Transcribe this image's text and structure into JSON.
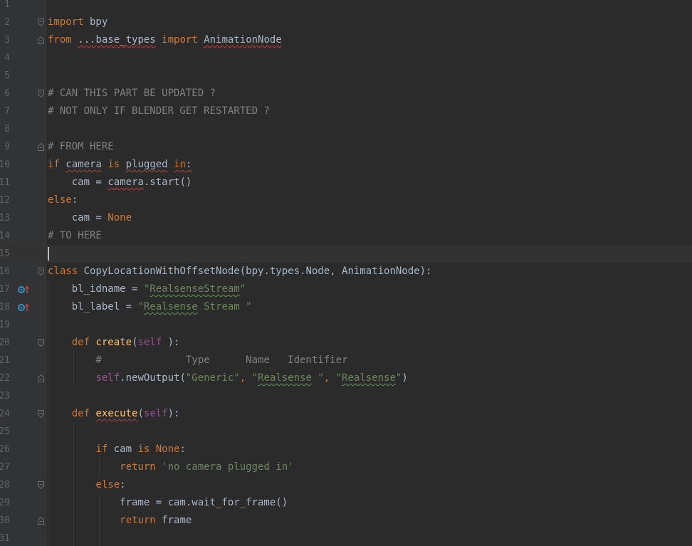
{
  "editor": {
    "language": "python",
    "current_line": "15",
    "colors": {
      "background": "#2b2b2b",
      "gutter": "#313335",
      "line_number": "#606366",
      "keyword": "#cc7832",
      "comment": "#808080",
      "string": "#6a8759",
      "self": "#94558d",
      "function": "#ffc66d",
      "text": "#a9b7c6",
      "warning_red": "#bc3f3c",
      "typo_green": "#629755",
      "override_icon": "#3592c4"
    },
    "lines": [
      {
        "n": "1",
        "tokens": []
      },
      {
        "n": "2",
        "fold": "start",
        "tokens": [
          {
            "t": "import",
            "c": "kw"
          },
          {
            "t": " bpy",
            "c": "tx"
          }
        ]
      },
      {
        "n": "3",
        "fold": "end",
        "tokens": [
          {
            "t": "from",
            "c": "kw"
          },
          {
            "t": " ",
            "c": "tx"
          },
          {
            "t": "...base_types",
            "c": "tx",
            "u": "red"
          },
          {
            "t": " ",
            "c": "tx"
          },
          {
            "t": "import",
            "c": "kw"
          },
          {
            "t": " ",
            "c": "tx"
          },
          {
            "t": "AnimationNode",
            "c": "tx",
            "u": "red"
          }
        ]
      },
      {
        "n": "4",
        "tokens": []
      },
      {
        "n": "5",
        "tokens": []
      },
      {
        "n": "6",
        "fold": "start",
        "tokens": [
          {
            "t": "# CAN THIS PART BE UPDATED ?",
            "c": "cm"
          }
        ]
      },
      {
        "n": "7",
        "tokens": [
          {
            "t": "# NOT ONLY IF BLENDER GET RESTARTED ?",
            "c": "cm"
          }
        ]
      },
      {
        "n": "8",
        "tokens": []
      },
      {
        "n": "9",
        "fold": "end",
        "tokens": [
          {
            "t": "# FROM HERE",
            "c": "cm"
          }
        ]
      },
      {
        "n": "10",
        "tokens": [
          {
            "t": "if",
            "c": "kw"
          },
          {
            "t": " ",
            "c": "tx"
          },
          {
            "t": "camera",
            "c": "tx",
            "u": "red"
          },
          {
            "t": " ",
            "c": "tx"
          },
          {
            "t": "is",
            "c": "kw"
          },
          {
            "t": " ",
            "c": "tx"
          },
          {
            "t": "plugged",
            "c": "tx",
            "u": "red"
          },
          {
            "t": " ",
            "c": "tx"
          },
          {
            "t": "in",
            "c": "kw",
            "u": "red"
          },
          {
            "t": ":",
            "c": "tx",
            "u": "red"
          }
        ]
      },
      {
        "n": "11",
        "tokens": [
          {
            "t": "    cam = ",
            "c": "tx"
          },
          {
            "t": "camera",
            "c": "tx",
            "u": "red"
          },
          {
            "t": ".start()",
            "c": "tx"
          }
        ]
      },
      {
        "n": "12",
        "tokens": [
          {
            "t": "else",
            "c": "kw"
          },
          {
            "t": ":",
            "c": "tx"
          }
        ]
      },
      {
        "n": "13",
        "tokens": [
          {
            "t": "    cam = ",
            "c": "tx"
          },
          {
            "t": "None",
            "c": "kw"
          }
        ]
      },
      {
        "n": "14",
        "tokens": [
          {
            "t": "# TO HERE",
            "c": "cm"
          }
        ]
      },
      {
        "n": "15",
        "current": true,
        "tokens": []
      },
      {
        "n": "16",
        "fold": "start",
        "tokens": [
          {
            "t": "class",
            "c": "kw"
          },
          {
            "t": " CopyLocationWithOffsetNode(bpy.types.Node, AnimationNode):",
            "c": "tx"
          }
        ]
      },
      {
        "n": "17",
        "icon": "override",
        "tokens": [
          {
            "t": "    bl_idname = ",
            "c": "tx"
          },
          {
            "t": "\"",
            "c": "st"
          },
          {
            "t": "RealsenseStream",
            "c": "st",
            "u": "green"
          },
          {
            "t": "\"",
            "c": "st"
          }
        ]
      },
      {
        "n": "18",
        "icon": "override",
        "tokens": [
          {
            "t": "    bl_label = ",
            "c": "tx"
          },
          {
            "t": "\"",
            "c": "st"
          },
          {
            "t": "Realsense",
            "c": "st",
            "u": "green"
          },
          {
            "t": " Stream \"",
            "c": "st"
          }
        ]
      },
      {
        "n": "19",
        "tokens": []
      },
      {
        "n": "20",
        "fold": "start",
        "tokens": [
          {
            "t": "    ",
            "c": "tx"
          },
          {
            "t": "def",
            "c": "kw"
          },
          {
            "t": " ",
            "c": "tx"
          },
          {
            "t": "create",
            "c": "fn"
          },
          {
            "t": "(",
            "c": "tx"
          },
          {
            "t": "self",
            "c": "sf"
          },
          {
            "t": " ):",
            "c": "tx"
          }
        ]
      },
      {
        "n": "21",
        "tokens": [
          {
            "t": "        #              Type      Name   Identifier",
            "c": "cm"
          }
        ]
      },
      {
        "n": "22",
        "fold": "end",
        "tokens": [
          {
            "t": "        ",
            "c": "tx"
          },
          {
            "t": "self",
            "c": "sf"
          },
          {
            "t": ".newOutput(",
            "c": "tx"
          },
          {
            "t": "\"Generic\"",
            "c": "st"
          },
          {
            "t": ", ",
            "c": "kw"
          },
          {
            "t": "\"",
            "c": "st"
          },
          {
            "t": "Realsense",
            "c": "st",
            "u": "green"
          },
          {
            "t": " \"",
            "c": "st"
          },
          {
            "t": ", ",
            "c": "kw"
          },
          {
            "t": "\"",
            "c": "st"
          },
          {
            "t": "Realsense",
            "c": "st",
            "u": "green"
          },
          {
            "t": "\"",
            "c": "st"
          },
          {
            "t": ")",
            "c": "tx"
          }
        ]
      },
      {
        "n": "23",
        "tokens": []
      },
      {
        "n": "24",
        "fold": "start",
        "tokens": [
          {
            "t": "    ",
            "c": "tx"
          },
          {
            "t": "def",
            "c": "kw"
          },
          {
            "t": " ",
            "c": "tx"
          },
          {
            "t": "execute",
            "c": "fn",
            "u": "red"
          },
          {
            "t": "(",
            "c": "tx"
          },
          {
            "t": "self",
            "c": "sf"
          },
          {
            "t": "):",
            "c": "tx"
          }
        ]
      },
      {
        "n": "25",
        "tokens": []
      },
      {
        "n": "26",
        "tokens": [
          {
            "t": "        ",
            "c": "tx"
          },
          {
            "t": "if",
            "c": "kw"
          },
          {
            "t": " cam ",
            "c": "tx"
          },
          {
            "t": "is",
            "c": "kw"
          },
          {
            "t": " ",
            "c": "tx"
          },
          {
            "t": "None",
            "c": "kw"
          },
          {
            "t": ":",
            "c": "tx"
          }
        ]
      },
      {
        "n": "27",
        "tokens": [
          {
            "t": "            ",
            "c": "tx"
          },
          {
            "t": "return",
            "c": "kw"
          },
          {
            "t": " ",
            "c": "tx"
          },
          {
            "t": "'no camera plugged in'",
            "c": "st"
          }
        ]
      },
      {
        "n": "28",
        "fold": "start",
        "tokens": [
          {
            "t": "        ",
            "c": "tx"
          },
          {
            "t": "else",
            "c": "kw"
          },
          {
            "t": ":",
            "c": "tx"
          }
        ]
      },
      {
        "n": "29",
        "tokens": [
          {
            "t": "            frame = cam.wait_for_frame()",
            "c": "tx"
          }
        ]
      },
      {
        "n": "30",
        "fold": "end",
        "tokens": [
          {
            "t": "            ",
            "c": "tx"
          },
          {
            "t": "return",
            "c": "kw"
          },
          {
            "t": " frame",
            "c": "tx"
          }
        ]
      },
      {
        "n": "31",
        "tokens": []
      }
    ]
  }
}
